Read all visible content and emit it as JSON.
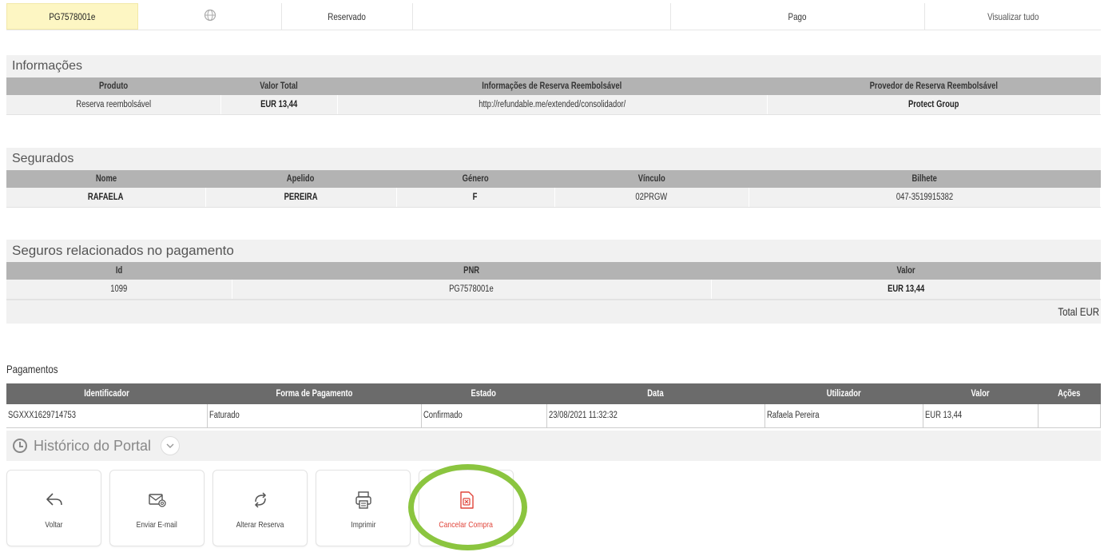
{
  "summary": {
    "pnr": "PG7578001e",
    "status": "Reservado",
    "payment_status": "Pago",
    "view_all": "Visualizar tudo"
  },
  "info": {
    "title": "Informações",
    "headers": [
      "Produto",
      "Valor Total",
      "Informações de Reserva Reembolsável",
      "Provedor de Reserva Reembolsável"
    ],
    "row": [
      "Reserva reembolsável",
      "EUR 13,44",
      "http://refundable.me/extended/consolidador/",
      "Protect Group"
    ]
  },
  "insured": {
    "title": "Segurados",
    "headers": [
      "Nome",
      "Apelido",
      "Género",
      "Vínculo",
      "Bilhete"
    ],
    "row": [
      "RAFAELA",
      "PEREIRA",
      "F",
      "02PRGW",
      "047-3519915382"
    ]
  },
  "related": {
    "title": "Seguros relacionados no pagamento",
    "headers": [
      "Id",
      "PNR",
      "Valor"
    ],
    "row": [
      "1099",
      "PG7578001e",
      "EUR 13,44"
    ],
    "total_label": "Total EUR"
  },
  "payments": {
    "title": "Pagamentos",
    "headers": [
      "Identificador",
      "Forma de Pagamento",
      "Estado",
      "Data",
      "Utilizador",
      "Valor",
      "Ações"
    ],
    "row": [
      "SGXXX1629714753",
      "Faturado",
      "Confirmado",
      "23/08/2021 11:32:32",
      "Rafaela Pereira",
      "EUR 13,44",
      ""
    ]
  },
  "history": {
    "label": "Histórico do Portal"
  },
  "actions": [
    {
      "label": "Voltar",
      "icon": "back-arrow-icon"
    },
    {
      "label": "Enviar E-mail",
      "icon": "email-icon"
    },
    {
      "label": "Alterar Reserva",
      "icon": "swap-icon"
    },
    {
      "label": "Imprimir",
      "icon": "printer-icon"
    },
    {
      "label": "Cancelar Compra",
      "icon": "cancel-document-icon"
    }
  ],
  "colors": {
    "highlight": "#8bc53f",
    "danger": "#e0443a",
    "pnr_bg": "#fdf6c3"
  }
}
